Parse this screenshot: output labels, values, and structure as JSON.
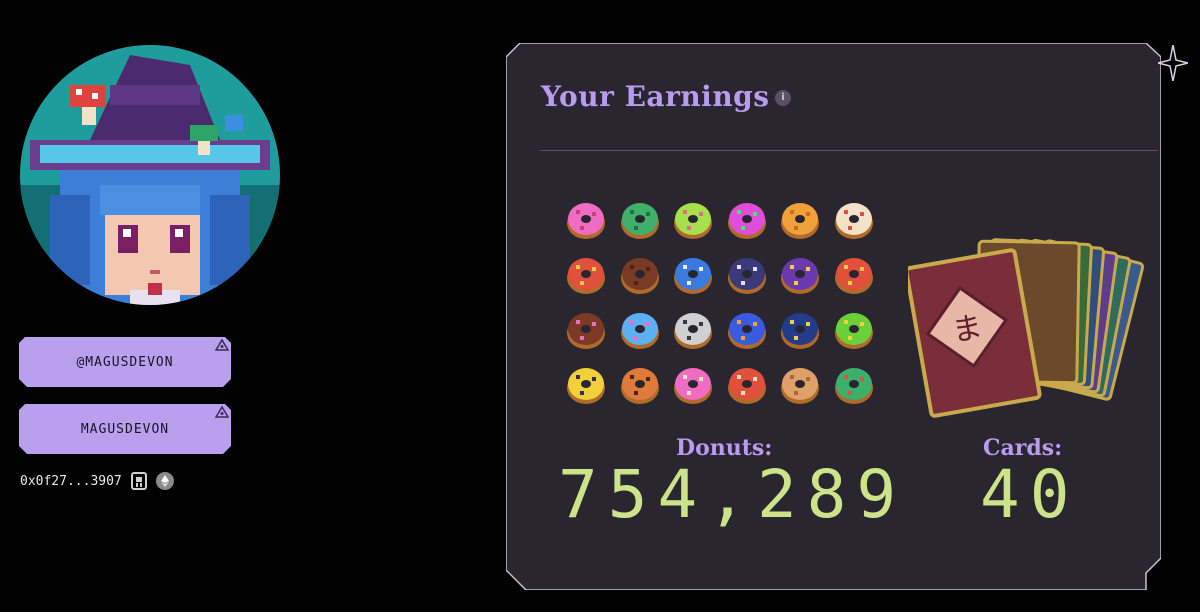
{
  "profile": {
    "handle_primary": "@MAGUSDEVON",
    "handle_secondary": "MAGUSDEVON",
    "wallet_address": "0x0f27...3907",
    "avatar_icon": "pixel-witch-avatar",
    "wallet_icons": [
      "ronin-icon",
      "ethereum-icon"
    ]
  },
  "earnings": {
    "title": "Your Earnings",
    "info_icon_glyph": "i",
    "donuts_label": "Donuts:",
    "donuts_value": "754,289",
    "cards_label": "Cards:",
    "cards_value": "40",
    "donut_icons": [
      [
        "pink-donut",
        "green-sprinkle-donut",
        "lime-drip-donut",
        "rainbow-donut",
        "orange-donut",
        "cream-donut"
      ],
      [
        "swirl-donut",
        "chocolate-donut",
        "blue-striped-donut",
        "omega-donut",
        "star-donut",
        "sunglasses-donut"
      ],
      [
        "choc-sprinkle-donut",
        "blue-sprinkle-donut",
        "skull-donut",
        "blue-galaxy-donut",
        "moon-donut",
        "smiley-donut"
      ],
      [
        "bat-donut",
        "cat-donut",
        "pink-bite-donut",
        "sushi-donut",
        "toast-donut",
        "frog-donut"
      ]
    ]
  },
  "colors": {
    "background": "#000000",
    "panel": "#2a2630",
    "accent_purple": "#b99bef",
    "value_green": "#cde389",
    "button_purple": "#b9a0ef"
  }
}
